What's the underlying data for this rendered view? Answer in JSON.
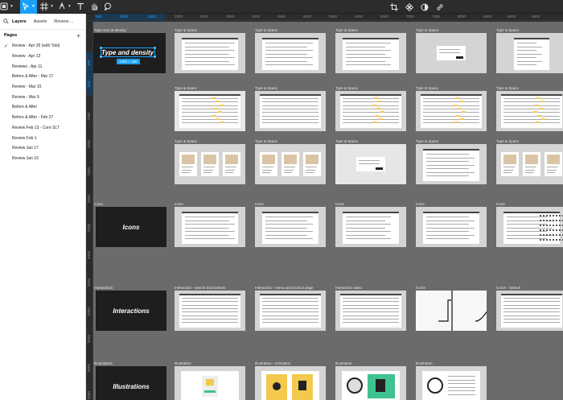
{
  "toolbar": {
    "tools": [
      "menu-icon",
      "move-tool-icon",
      "frame-tool-icon",
      "pen-tool-icon",
      "text-tool-icon",
      "hand-tool-icon",
      "comment-tool-icon"
    ],
    "right_tools": [
      "crop-icon",
      "components-icon",
      "contrast-icon",
      "link-icon"
    ],
    "accent": "#18a0fb"
  },
  "left_panel": {
    "tabs": [
      "Layers",
      "Assets",
      "Review ..."
    ],
    "pages_header": "Pages",
    "add_label": "+",
    "checkmark": "✓",
    "pages": [
      "Review - Apr 26 (with Tobi)",
      "Review - Apr 13",
      "Reviews - Apr 11",
      "Before & After - Mar 17",
      "Review - Mar 15",
      "Review - Mar 9",
      "Before & After",
      "Before & After - Feb 27",
      "Review Feb 13 - Core SLT",
      "Review Feb 1",
      "Review Jan 17",
      "Review Jan 10"
    ],
    "current_page_index": 0
  },
  "rulers": {
    "top": [
      "280",
      "1000",
      "1640",
      "2500",
      "3000",
      "3500",
      "4000",
      "4500",
      "5000",
      "5500",
      "6000",
      "6500",
      "7000",
      "7500",
      "8000",
      "8500",
      "9000",
      "9500",
      "10000",
      "10500",
      "11000",
      "11500",
      "12000",
      "12500",
      "13000"
    ],
    "top_selected": [
      "280",
      "1000",
      "1640"
    ],
    "left": [
      "480",
      "820",
      "1500",
      "2000",
      "2500",
      "3000",
      "3500",
      "4000",
      "4500",
      "5000",
      "5500",
      "6000",
      "6500",
      "7000",
      "7500",
      "8000",
      "8500"
    ],
    "left_selected": [
      "480",
      "820"
    ]
  },
  "canvas": {
    "rows": [
      {
        "section_label": "Type and UI density",
        "section_title": "Type and density",
        "size_badge": "1360 × 160",
        "frames": [
          "Type & Space",
          "Type & Space",
          "Type & Space",
          "Type & Space",
          "Type & Space"
        ]
      },
      {
        "section_label": "",
        "frames": [
          "Type & Space",
          "Type & Space",
          "Type & Space",
          "Type & Space",
          "Type & Space"
        ]
      },
      {
        "section_label": "",
        "frames": [
          "Type & Space",
          "Type & Space",
          "Type & Space",
          "Type & Space",
          "Type & Space"
        ]
      },
      {
        "section_label": "Icons",
        "section_title": "Icons",
        "frames": [
          "Icons",
          "Icons",
          "Icons",
          "Icons",
          "Icons"
        ]
      },
      {
        "section_label": "Interactions",
        "section_title": "Interactions",
        "frames": [
          "Interaction - search and buttons",
          "Interaction - menu and product page",
          "Interaction video",
          "Curve",
          "Curve - Search"
        ]
      },
      {
        "section_label": "Illustrations",
        "section_title": "Illustrations",
        "frames": [
          "Illustration",
          "Illustration - Animation",
          "Illustration",
          "Illustration"
        ]
      }
    ]
  }
}
